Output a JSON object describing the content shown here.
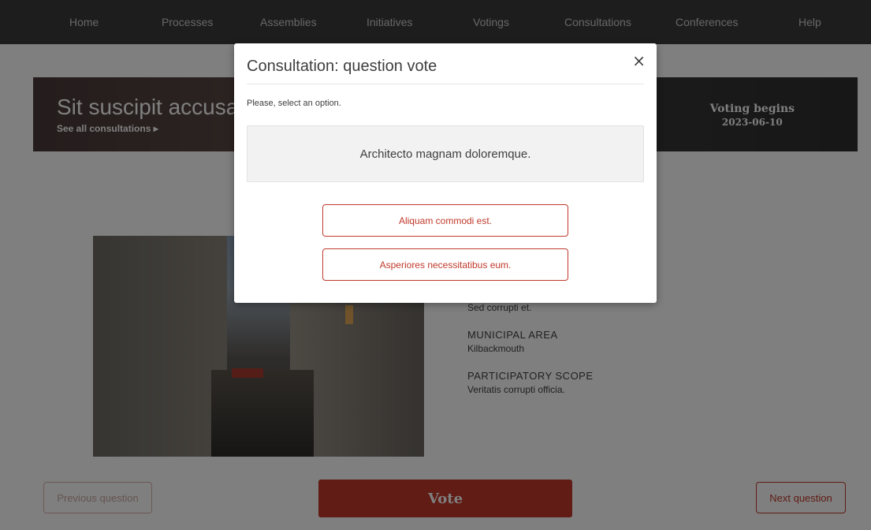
{
  "nav": {
    "items": [
      "Home",
      "Processes",
      "Assemblies",
      "Initiatives",
      "Votings",
      "Consultations",
      "Conferences",
      "Help"
    ]
  },
  "hero": {
    "title": "Sit suscipit accusar",
    "link": "See all consultations ▸",
    "voting_label": "Voting begins",
    "voting_date": "2023-06-10"
  },
  "info": {
    "first_value": "Sed corrupti et.",
    "municipal_area_heading": "MUNICIPAL AREA",
    "municipal_area_value": "Kilbackmouth",
    "participatory_scope_heading": "PARTICIPATORY SCOPE",
    "participatory_scope_value": "Veritatis corrupti officia."
  },
  "buttons": {
    "previous": "Previous question",
    "vote": "Vote",
    "next": "Next question"
  },
  "modal": {
    "title": "Consultation: question vote",
    "close": "×",
    "instruction": "Please, select an option.",
    "question": "Architecto magnam doloremque.",
    "options": [
      "Aliquam commodi est.",
      "Asperiores necessitatibus eum."
    ]
  },
  "colors": {
    "accent": "#c0392b",
    "nav_bg": "#3b3b3b",
    "overlay": "rgba(0,0,0,0.5)"
  }
}
